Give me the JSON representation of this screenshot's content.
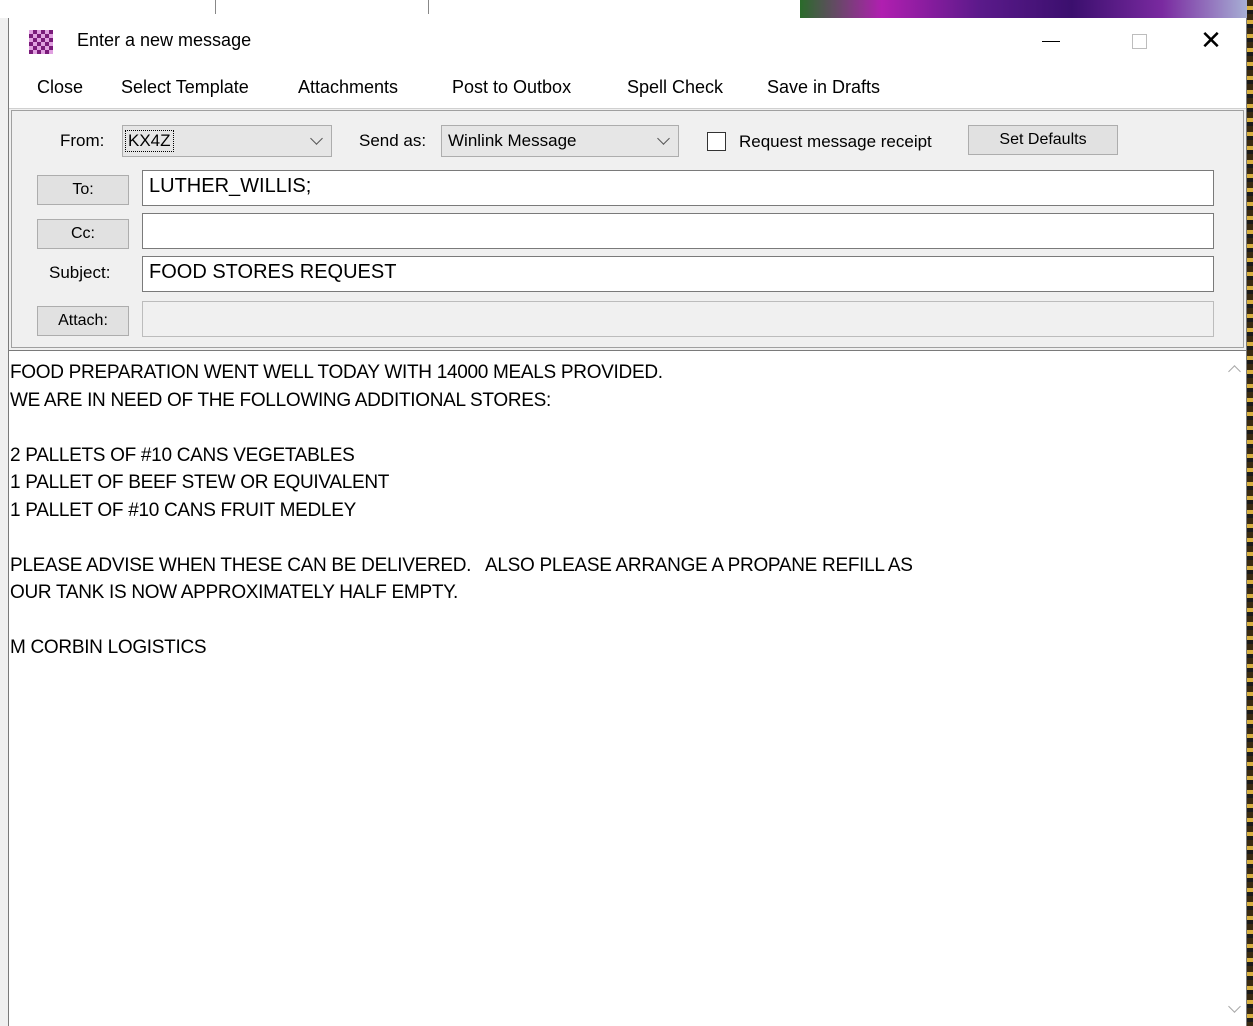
{
  "window": {
    "title": "Enter a new message"
  },
  "menu": {
    "items": [
      "Close",
      "Select Template",
      "Attachments",
      "Post to Outbox",
      "Spell Check",
      "Save in Drafts"
    ]
  },
  "header": {
    "from_label": "From:",
    "from_value": "KX4Z",
    "send_as_label": "Send as:",
    "send_as_value": "Winlink Message",
    "request_receipt_label": "Request message receipt",
    "request_receipt_checked": false,
    "set_defaults_label": "Set Defaults",
    "to_button": "To:",
    "to_value": "LUTHER_WILLIS;",
    "cc_button": "Cc:",
    "cc_value": "",
    "subject_label": "Subject:",
    "subject_value": "FOOD STORES REQUEST",
    "attach_button": "Attach:",
    "attach_value": ""
  },
  "message": {
    "body": "FOOD PREPARATION WENT WELL TODAY WITH 14000 MEALS PROVIDED.\nWE ARE IN NEED OF THE FOLLOWING ADDITIONAL STORES:\n\n2 PALLETS OF #10 CANS VEGETABLES\n1 PALLET OF BEEF STEW OR EQUIVALENT\n1 PALLET OF #10 CANS FRUIT MEDLEY\n\nPLEASE ADVISE WHEN THESE CAN BE DELIVERED.   ALSO PLEASE ARRANGE A PROPANE REFILL AS\nOUR TANK IS NOW APPROXIMATELY HALF EMPTY.\n\nM CORBIN LOGISTICS"
  }
}
